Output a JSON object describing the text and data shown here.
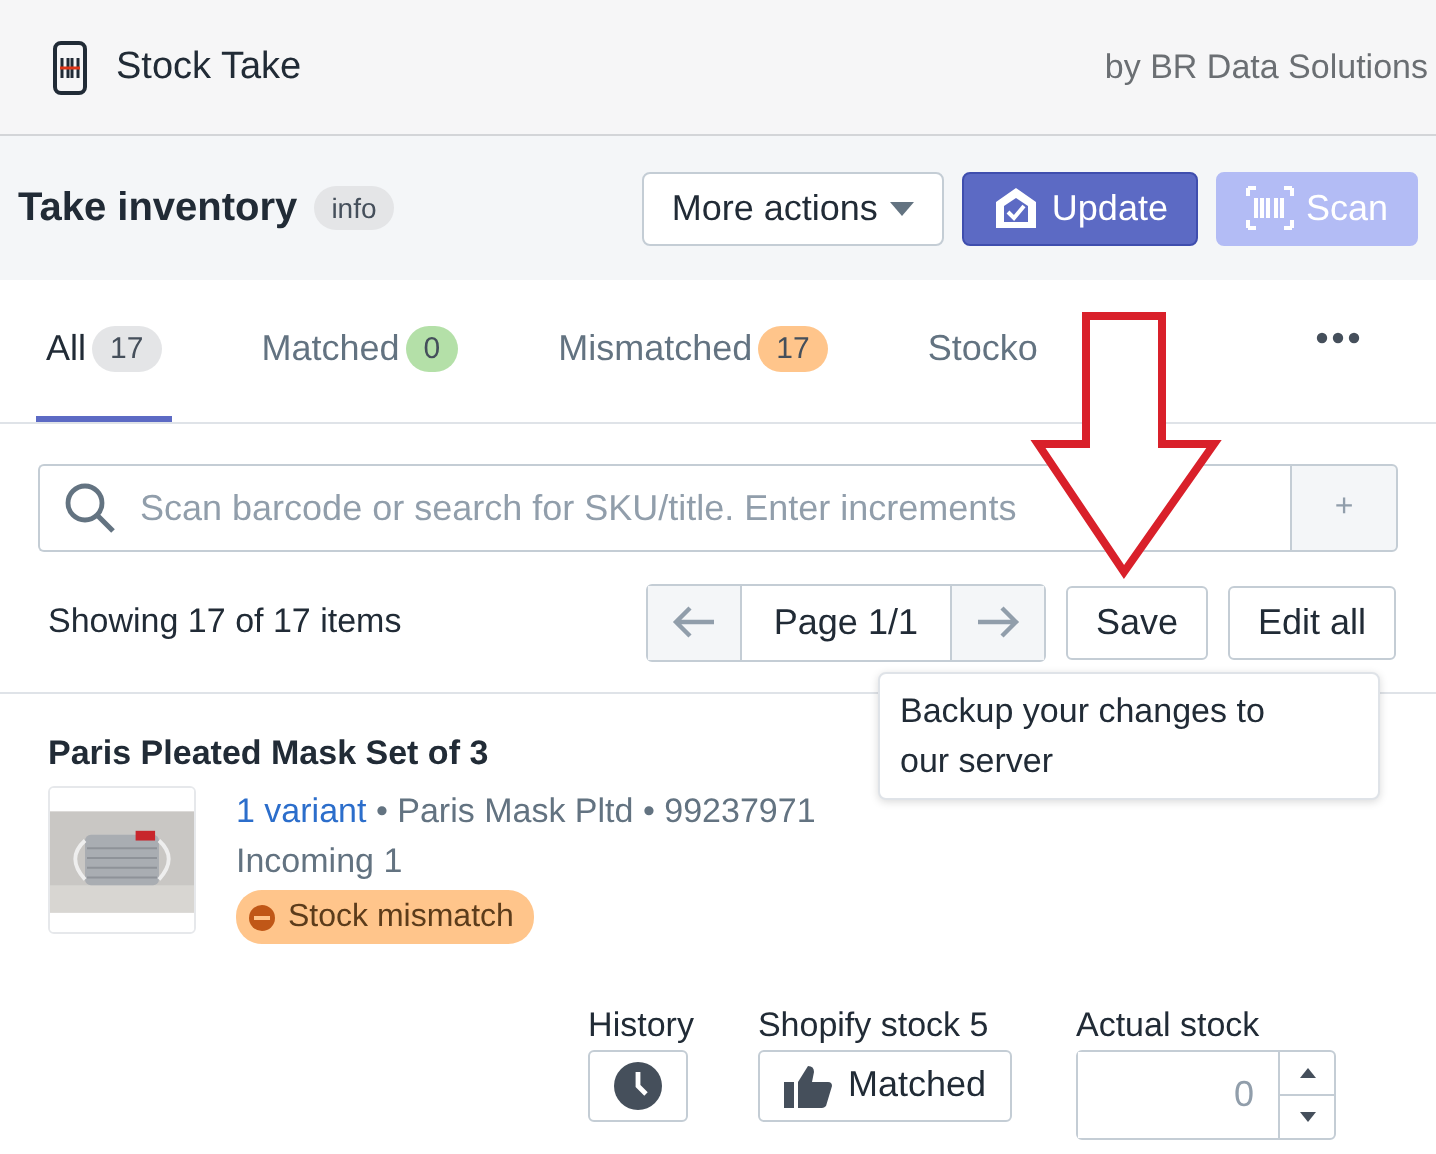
{
  "header": {
    "app_name": "Stock Take",
    "vendor": "by BR Data Solutions"
  },
  "page": {
    "title": "Take inventory",
    "title_badge": "info"
  },
  "actions": [
    {
      "label": "More actions",
      "kind": "menu",
      "disabled": false
    },
    {
      "label": "Update",
      "kind": "primary",
      "disabled": false
    },
    {
      "label": "Scan",
      "kind": "primary",
      "disabled": true
    }
  ],
  "tabs": [
    {
      "label": "All",
      "count": "17",
      "color": "#e4e5e7",
      "selected": true
    },
    {
      "label": "Matched",
      "count": "0",
      "color": "#b4e0a8",
      "selected": false
    },
    {
      "label": "Mismatched",
      "count": "17",
      "color": "#ffc58b",
      "selected": false
    },
    {
      "label": "Stocko",
      "selected": false
    }
  ],
  "search": {
    "placeholder": "Scan barcode or search for SKU/title. Enter increments",
    "add_button": "+"
  },
  "summary": "Showing 17 of 17 items",
  "pagination": {
    "page": "Page 1/1"
  },
  "buttons": [
    "Save",
    "Edit all"
  ],
  "tooltip": "Backup your changes to our server",
  "product": {
    "title": "Paris Pleated Mask Set of 3",
    "variants_link": "1 variant",
    "separator": "•",
    "vendor": "Paris Mask Pltd",
    "barcode": "99237971",
    "incoming": "Incoming 1",
    "status": "Stock mismatch",
    "history_label": "History",
    "shopify_stock": "Shopify stock 5",
    "match_button": "Matched",
    "actual_label": "Actual stock",
    "actual_value": "0"
  }
}
